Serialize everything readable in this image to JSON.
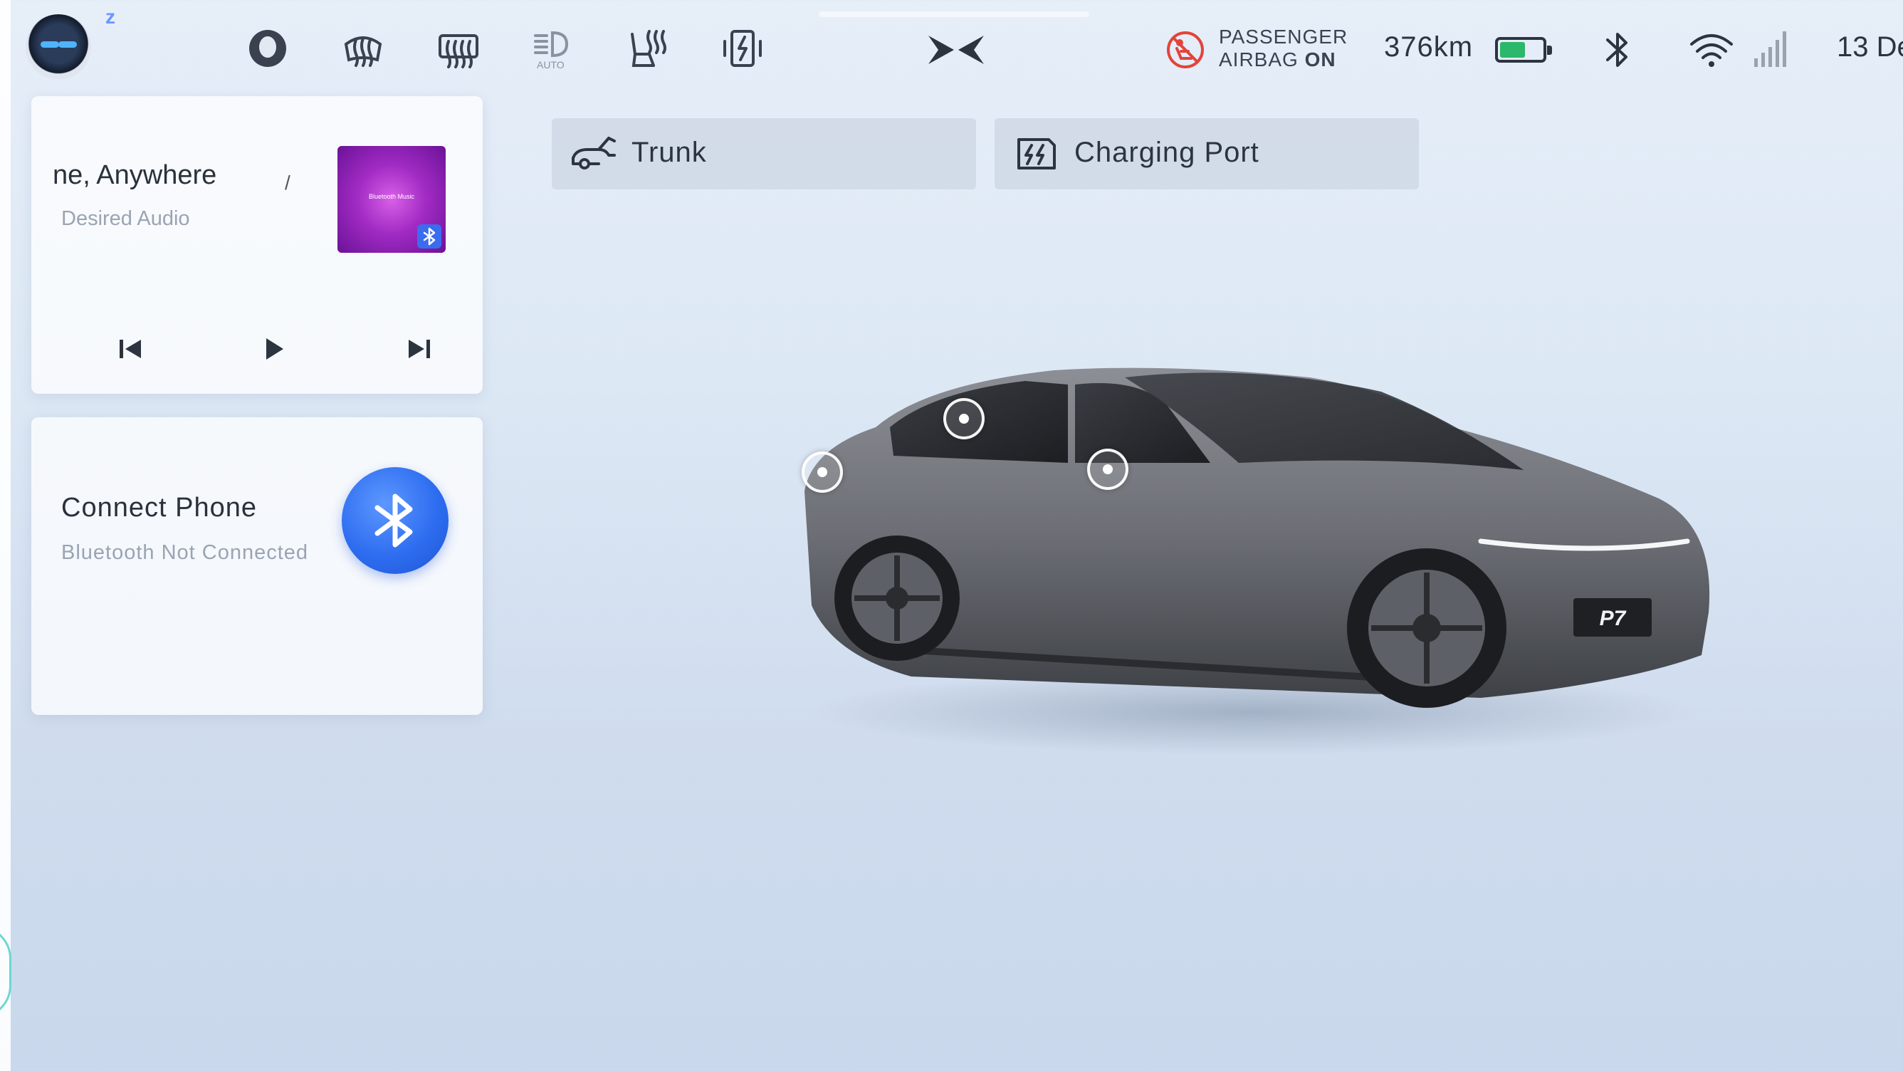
{
  "status_bar": {
    "assistant_icon": "assistant-robot-avatar",
    "sleep_indicator": "z",
    "quick_icons": [
      "user-profile-icon",
      "front-defrost-icon",
      "rear-defrost-icon",
      "auto-headlight-icon",
      "seat-heating-icon",
      "charging-status-icon"
    ],
    "auto_label": "AUTO",
    "logo": "xpeng-logo",
    "airbag": {
      "line1": "PASSENGER",
      "line2_prefix": "AIRBAG ",
      "line2_state": "ON"
    },
    "range": "376km",
    "battery_level": 0.6,
    "battery_color": "#2bb86a",
    "bluetooth_icon": "bluetooth-icon",
    "wifi_icon": "wifi-icon",
    "signal_icon": "cellular-signal-icon",
    "date": "13 De"
  },
  "music_card": {
    "title": "ne, Anywhere",
    "tick": "/",
    "subtitle": "Desired Audio",
    "album_label": "Bluetooth Music",
    "controls": [
      "previous-icon",
      "play-icon",
      "next-icon"
    ]
  },
  "phone_card": {
    "title": "Connect Phone",
    "subtitle": "Bluetooth Not Connected",
    "button_icon": "bluetooth-icon"
  },
  "shortcuts": {
    "trunk": "Trunk",
    "charging_port": "Charging Port"
  },
  "car": {
    "plate": "P7",
    "hotspots": [
      "rear-door-hotspot",
      "rear-window-hotspot",
      "front-door-hotspot"
    ]
  },
  "colors": {
    "accent_blue": "#2e6df0",
    "album_purple": "#a22bc4",
    "battery_green": "#2bb86a"
  }
}
